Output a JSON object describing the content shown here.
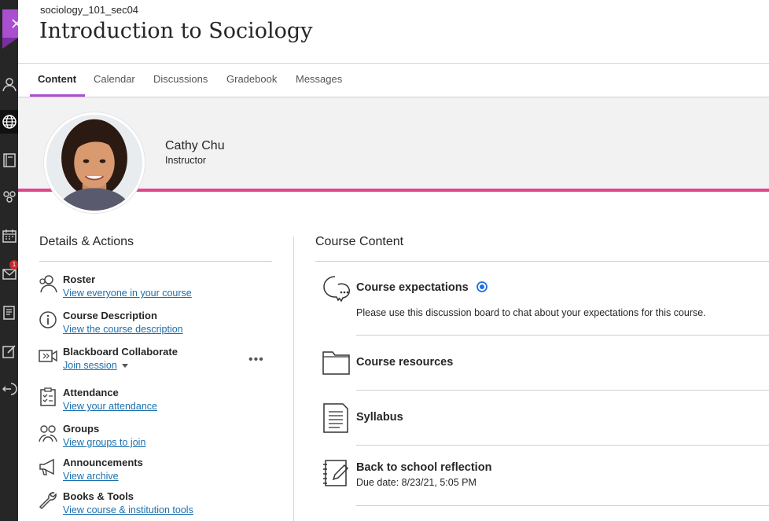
{
  "header": {
    "course_id": "sociology_101_sec04",
    "course_title": "Introduction to Sociology"
  },
  "tabs": [
    {
      "label": "Content"
    },
    {
      "label": "Calendar"
    },
    {
      "label": "Discussions"
    },
    {
      "label": "Gradebook"
    },
    {
      "label": "Messages"
    }
  ],
  "instructor": {
    "name": "Cathy Chu",
    "role": "Instructor"
  },
  "nav_rail": {
    "icons": [
      "profile-icon",
      "globe-icon",
      "book-icon",
      "people-icon",
      "calendar-icon",
      "mail-icon",
      "notes-icon",
      "edit-icon",
      "sign-out-icon"
    ],
    "mail_badge": "1"
  },
  "details": {
    "title": "Details & Actions",
    "items": [
      {
        "title": "Roster",
        "link": "View everyone in your course",
        "icon": "roster-icon"
      },
      {
        "title": "Course Description",
        "link": "View the course description",
        "icon": "info-icon"
      },
      {
        "title": "Blackboard Collaborate",
        "link": "Join session",
        "icon": "collaborate-icon"
      },
      {
        "title": "Attendance",
        "link": "View your attendance",
        "icon": "clipboard-icon"
      },
      {
        "title": "Groups",
        "link": "View groups to join",
        "icon": "groups-icon"
      },
      {
        "title": "Announcements",
        "link": "View archive",
        "icon": "megaphone-icon"
      },
      {
        "title": "Books & Tools",
        "link": "View course & institution tools",
        "icon": "wrench-icon"
      }
    ],
    "more_label": "•••"
  },
  "course_content": {
    "title": "Course Content",
    "items": [
      {
        "title": "Course expectations",
        "description": "Please use this discussion board to chat about your expectations for this course.",
        "icon": "discussion-icon"
      },
      {
        "title": "Course resources",
        "icon": "folder-icon"
      },
      {
        "title": "Syllabus",
        "icon": "document-icon"
      },
      {
        "title": "Back to school reflection",
        "due": "Due date: 8/23/21, 5:05 PM",
        "icon": "journal-icon"
      }
    ]
  },
  "colors": {
    "accent_purple": "#a94fd0",
    "banner_pink": "#e0468c",
    "link_blue": "#1a6fad",
    "new_badge_blue": "#1f6fe0",
    "rail_dark": "#262626"
  }
}
